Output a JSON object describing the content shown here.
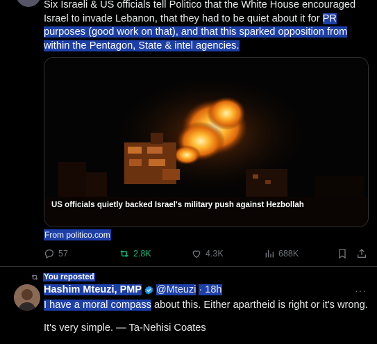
{
  "tweet1": {
    "text_before": "Six Israeli & US officials tell Politico that the White House encouraged Israel to invade Lebanon, that they had to be quiet about it for ",
    "text_highlight": "PR purposes (good work on that), and that this sparked opposition from within the Pentagon, State & intel agencies.",
    "media_caption": "US officials quietly backed Israel's military push against Hezbollah",
    "source": "From politico.com",
    "actions": {
      "replies": "57",
      "reposts": "2.8K",
      "likes": "4.3K",
      "views": "688K"
    }
  },
  "tweet2": {
    "repost_label": "You reposted",
    "author_name": "Hashim Mteuzi, PMP",
    "handle": "@Mteuzi",
    "time": "· 18h",
    "text_highlight": "I have a moral compass",
    "text_rest": " about this. Either apartheid is right or it's wrong.",
    "text_line2": "It's very simple. — Ta-Nehisi Coates",
    "more": "···"
  },
  "colors": {
    "background": "#000000",
    "text": "#e7e9ea",
    "muted": "#71767b",
    "repost_green": "#00ba7c",
    "verified_blue": "#1d9bf0",
    "selection_highlight": "#1d3fa8"
  },
  "icons": [
    "reply-icon",
    "repost-icon",
    "like-icon",
    "views-icon",
    "bookmark-icon",
    "share-icon",
    "verified-badge-icon",
    "more-icon"
  ]
}
